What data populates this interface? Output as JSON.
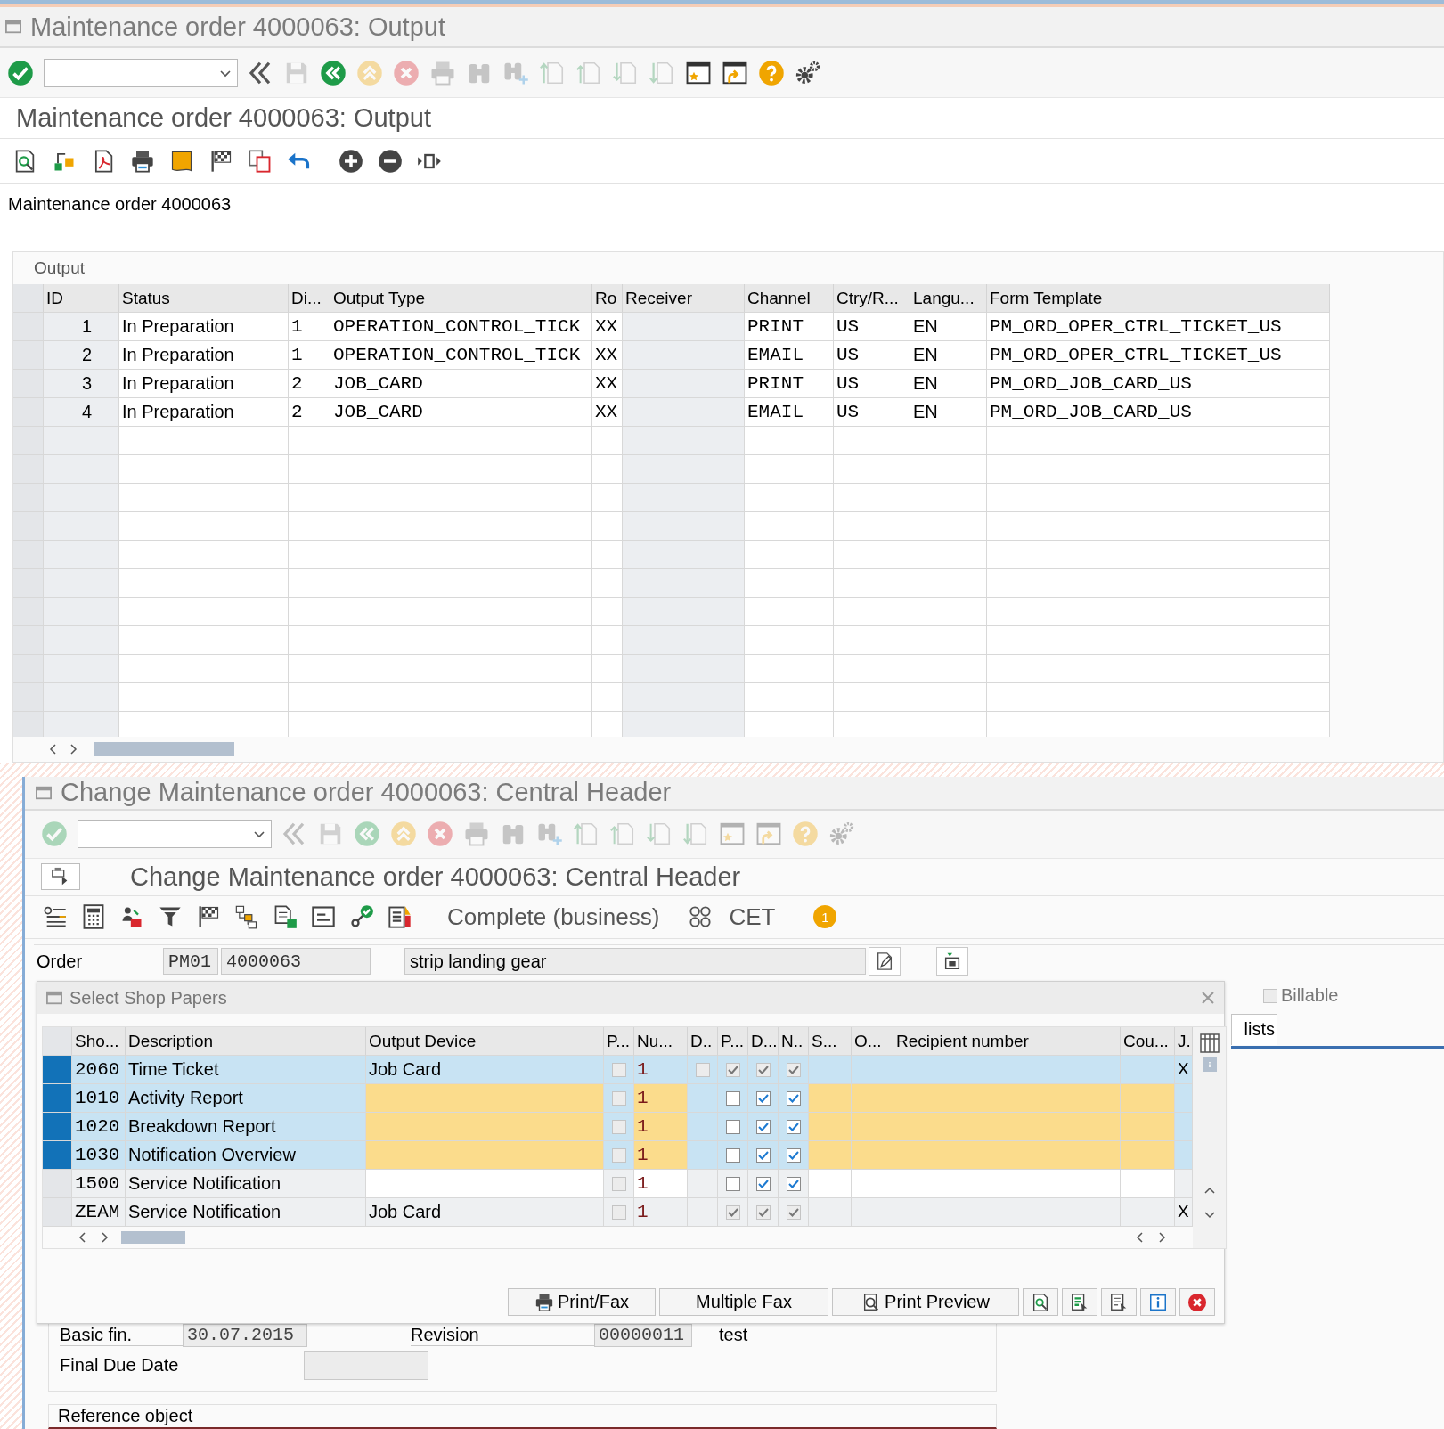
{
  "output_window": {
    "title": "Maintenance order 4000063: Output",
    "toolbar": [
      {
        "kind": "enter",
        "disabled": false
      },
      {
        "kind": "command",
        "disabled": false
      },
      {
        "kind": "back_double",
        "disabled": false
      },
      {
        "kind": "save",
        "disabled": true
      },
      {
        "kind": "back",
        "disabled": false
      },
      {
        "kind": "exit",
        "disabled": true
      },
      {
        "kind": "cancel",
        "disabled": true
      },
      {
        "kind": "print",
        "disabled": true
      },
      {
        "kind": "find",
        "disabled": true
      },
      {
        "kind": "find_next",
        "disabled": true
      },
      {
        "kind": "first_page",
        "disabled": true
      },
      {
        "kind": "previous_page",
        "disabled": true
      },
      {
        "kind": "next_page",
        "disabled": true
      },
      {
        "kind": "last_page",
        "disabled": true
      },
      {
        "kind": "new_session",
        "disabled": false
      },
      {
        "kind": "shortcut",
        "disabled": false
      },
      {
        "kind": "help",
        "disabled": false
      },
      {
        "kind": "settings",
        "disabled": false
      }
    ],
    "screen_title": "Maintenance order 4000063: Output",
    "heading": "Maintenance order 4000063",
    "output_group": {
      "label": "Output",
      "columns": [
        "ID",
        "Status",
        "Di...",
        "Output Type",
        "Ro",
        "Receiver",
        "Channel",
        "Ctry/R...",
        "Langu...",
        "Form Template"
      ],
      "rows": [
        {
          "id": "1",
          "status": "In Preparation",
          "di": "1",
          "output_type": "OPERATION_CONTROL_TICK",
          "ro": "XX",
          "channel": "PRINT",
          "country": "US",
          "language": "EN",
          "form_template": "PM_ORD_OPER_CTRL_TICKET_US"
        },
        {
          "id": "2",
          "status": "In Preparation",
          "di": "1",
          "output_type": "OPERATION_CONTROL_TICK",
          "ro": "XX",
          "channel": "EMAIL",
          "country": "US",
          "language": "EN",
          "form_template": "PM_ORD_OPER_CTRL_TICKET_US"
        },
        {
          "id": "3",
          "status": "In Preparation",
          "di": "2",
          "output_type": "JOB_CARD",
          "ro": "XX",
          "channel": "PRINT",
          "country": "US",
          "language": "EN",
          "form_template": "PM_ORD_JOB_CARD_US"
        },
        {
          "id": "4",
          "status": "In Preparation",
          "di": "2",
          "output_type": "JOB_CARD",
          "ro": "XX",
          "channel": "EMAIL",
          "country": "US",
          "language": "EN",
          "form_template": "PM_ORD_JOB_CARD_US"
        }
      ]
    }
  },
  "central_header_window": {
    "title": "Change Maintenance order 4000063: Central Header",
    "toolbar": [
      {
        "kind": "enter",
        "disabled": true
      },
      {
        "kind": "command",
        "disabled": false
      },
      {
        "kind": "back_double",
        "disabled": true
      },
      {
        "kind": "save",
        "disabled": true
      },
      {
        "kind": "back",
        "disabled": true
      },
      {
        "kind": "exit",
        "disabled": true
      },
      {
        "kind": "cancel",
        "disabled": true
      },
      {
        "kind": "print",
        "disabled": true
      },
      {
        "kind": "find",
        "disabled": true
      },
      {
        "kind": "find_next",
        "disabled": true
      },
      {
        "kind": "first_page",
        "disabled": true
      },
      {
        "kind": "previous_page",
        "disabled": true
      },
      {
        "kind": "next_page",
        "disabled": true
      },
      {
        "kind": "last_page",
        "disabled": true
      },
      {
        "kind": "new_session",
        "disabled": true
      },
      {
        "kind": "shortcut",
        "disabled": true
      },
      {
        "kind": "help",
        "disabled": true
      },
      {
        "kind": "settings",
        "disabled": true
      }
    ],
    "screen_title": "Change Maintenance order 4000063: Central Header",
    "status": "Complete (business)",
    "timezone": "CET",
    "message_count": "1",
    "order": {
      "label": "Order",
      "order_type": "PM01",
      "number": "4000063",
      "description": "strip landing gear"
    },
    "billable": {
      "label": "Billable",
      "checked": false
    },
    "tab_fragment": "lists",
    "dates": {
      "basic_finish_label": "Basic fin.",
      "basic_finish": "30.07.2015",
      "revision_label": "Revision",
      "revision": "00000011",
      "revision_text": "test",
      "final_due_label": "Final Due Date"
    },
    "reference_object": "Reference object"
  },
  "dialog": {
    "title": "Select Shop Papers",
    "columns": [
      "Sho...",
      "Description",
      "Output Device",
      "P...",
      "Nu...",
      "D..",
      "P...",
      "D...",
      "N..",
      "S...",
      "O...",
      "Recipient number",
      "Cou...",
      "J."
    ],
    "rows": [
      {
        "selected": true,
        "editable": false,
        "shop_paper": "2060",
        "description": "Time Ticket",
        "output_device": "Job Card",
        "p_checked": false,
        "number": "1",
        "d_checked": false,
        "p2_checked": true,
        "d2_checked": true,
        "n_checked": true,
        "j": "X"
      },
      {
        "selected": true,
        "editable": true,
        "shop_paper": "1010",
        "description": "Activity Report",
        "p_checked": false,
        "number": "1",
        "p2_checked": false,
        "d2_checked": true,
        "n_checked": true
      },
      {
        "selected": true,
        "editable": true,
        "shop_paper": "1020",
        "description": "Breakdown Report",
        "p_checked": false,
        "number": "1",
        "p2_checked": false,
        "d2_checked": true,
        "n_checked": true
      },
      {
        "selected": true,
        "editable": true,
        "shop_paper": "1030",
        "description": "Notification Overview",
        "p_checked": false,
        "number": "1",
        "p2_checked": false,
        "d2_checked": true,
        "n_checked": true
      },
      {
        "selected": false,
        "editable": true,
        "shop_paper": "1500",
        "description": "Service Notification",
        "p_checked": false,
        "number": "1",
        "p2_checked": false,
        "d2_checked": true,
        "n_checked": true
      },
      {
        "selected": false,
        "editable": false,
        "shop_paper": "ZEAM",
        "description": "Service Notification",
        "output_device": "Job Card",
        "p_checked": false,
        "number": "1",
        "p2_checked": true,
        "d2_checked": true,
        "n_checked": true,
        "j": "X"
      }
    ],
    "buttons": [
      {
        "kind": "print",
        "label": "Print/Fax"
      },
      {
        "kind": "plain",
        "label": "Multiple Fax"
      },
      {
        "kind": "preview",
        "label": "Print Preview"
      },
      {
        "kind": "details"
      },
      {
        "kind": "select_all"
      },
      {
        "kind": "deselect_all"
      },
      {
        "kind": "info"
      },
      {
        "kind": "cancel"
      }
    ]
  }
}
